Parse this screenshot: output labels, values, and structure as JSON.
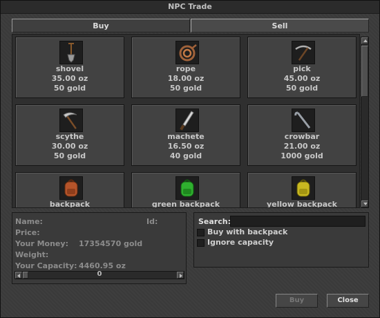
{
  "window": {
    "title": "NPC Trade"
  },
  "tabs": {
    "buy": "Buy",
    "sell": "Sell"
  },
  "items": [
    {
      "name": "shovel",
      "weight": "35.00 oz",
      "price": "50 gold",
      "icon": "shovel-icon"
    },
    {
      "name": "rope",
      "weight": "18.00 oz",
      "price": "50 gold",
      "icon": "rope-icon"
    },
    {
      "name": "pick",
      "weight": "45.00 oz",
      "price": "50 gold",
      "icon": "pick-icon"
    },
    {
      "name": "scythe",
      "weight": "30.00 oz",
      "price": "50 gold",
      "icon": "scythe-icon"
    },
    {
      "name": "machete",
      "weight": "16.50 oz",
      "price": "40 gold",
      "icon": "machete-icon"
    },
    {
      "name": "crowbar",
      "weight": "21.00 oz",
      "price": "1000 gold",
      "icon": "crowbar-icon"
    },
    {
      "name": "backpack",
      "weight": "",
      "price": "",
      "icon": "backpack-icon",
      "color": "#b5542a"
    },
    {
      "name": "green backpack",
      "weight": "",
      "price": "",
      "icon": "green-backpack-icon",
      "color": "#2fb02f"
    },
    {
      "name": "yellow backpack",
      "weight": "",
      "price": "",
      "icon": "yellow-backpack-icon",
      "color": "#c8b820"
    }
  ],
  "info": {
    "name_label": "Name:",
    "id_label": "Id:",
    "price_label": "Price:",
    "money_label": "Your Money:",
    "money_value": "17354570 gold",
    "weight_label": "Weight:",
    "capacity_label": "Your Capacity:",
    "capacity_value": "4460.95 oz",
    "amount_value": "0"
  },
  "options": {
    "search_label": "Search:",
    "search_value": "",
    "buy_with_backpack": "Buy with backpack",
    "ignore_capacity": "Ignore capacity"
  },
  "buttons": {
    "buy": "Buy",
    "close": "Close"
  }
}
